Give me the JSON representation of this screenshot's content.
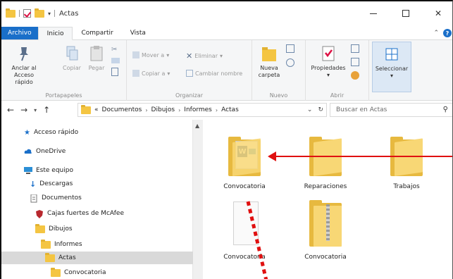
{
  "window": {
    "title": "Actas"
  },
  "ribbon_tabs": [
    "Archivo",
    "Inicio",
    "Compartir",
    "Vista"
  ],
  "ribbon": {
    "portapapeles": {
      "label": "Portapapeles",
      "pin_label_1": "Anclar al",
      "pin_label_2": "Acceso rápido",
      "copy": "Copiar",
      "paste": "Pegar"
    },
    "organizar": {
      "label": "Organizar",
      "move": "Mover a",
      "copy_to": "Copiar a",
      "delete": "Eliminar",
      "rename": "Cambiar nombre"
    },
    "nuevo": {
      "label": "Nuevo",
      "new_folder_1": "Nueva",
      "new_folder_2": "carpeta"
    },
    "abrir": {
      "label": "Abrir",
      "properties": "Propiedades"
    },
    "seleccionar": {
      "select": "Seleccionar"
    }
  },
  "address": {
    "crumbs": [
      "Documentos",
      "Dibujos",
      "Informes",
      "Actas"
    ],
    "prefix": "«",
    "search_placeholder": "Buscar en Actas"
  },
  "nav": {
    "items": [
      {
        "label": "Acceso rápido",
        "icon": "star-icon"
      },
      {
        "label": "OneDrive",
        "icon": "cloud-icon"
      },
      {
        "label": "Este equipo",
        "icon": "computer-icon"
      },
      {
        "label": "Descargas",
        "icon": "download-icon"
      },
      {
        "label": "Documentos",
        "icon": "document-icon"
      },
      {
        "label": "Cajas fuertes de McAfee",
        "icon": "shield-icon"
      },
      {
        "label": "Dibujos",
        "icon": "folder-icon"
      },
      {
        "label": "Informes",
        "icon": "folder-icon"
      },
      {
        "label": "Actas",
        "icon": "folder-icon"
      },
      {
        "label": "Convocatoria",
        "icon": "folder-icon"
      }
    ]
  },
  "files": [
    {
      "name": "Convocatoria",
      "type": "folder-with-word-doc"
    },
    {
      "name": "Reparaciones",
      "type": "folder"
    },
    {
      "name": "Trabajos",
      "type": "folder"
    },
    {
      "name": "Convocatoria",
      "type": "blank-document"
    },
    {
      "name": "Convocatoria",
      "type": "zip-folder"
    }
  ],
  "colors": {
    "accent": "#1a6fc9",
    "folder": "#f8d775",
    "annotation": "#e01010"
  }
}
